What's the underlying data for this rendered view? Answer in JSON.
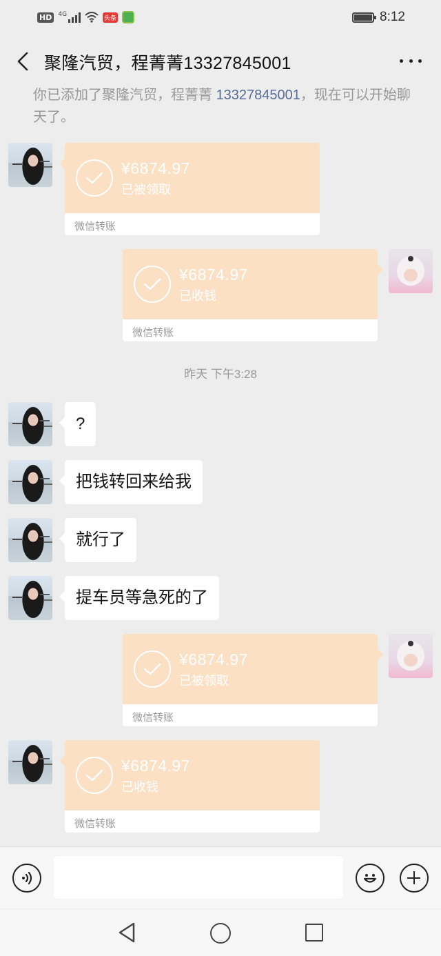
{
  "status_bar": {
    "hd": "HD",
    "network": "4G",
    "app_badge": "头条",
    "time": "8:12"
  },
  "header": {
    "title": "聚隆汽贸，程菁菁13327845001"
  },
  "system_notice": {
    "prefix": "你已添加了聚隆汽贸，程菁菁 ",
    "phone": "13327845001",
    "suffix": "，现在可以开始聊天了。"
  },
  "messages": [
    {
      "sender": "contact",
      "type": "transfer",
      "amount": "¥6874.97",
      "status": "已被领取",
      "footer": "微信转账"
    },
    {
      "sender": "me",
      "type": "transfer",
      "amount": "¥6874.97",
      "status": "已收钱",
      "footer": "微信转账"
    },
    {
      "type": "timestamp",
      "text": "昨天 下午3:28"
    },
    {
      "sender": "contact",
      "type": "text",
      "text": "?"
    },
    {
      "sender": "contact",
      "type": "text",
      "text": "把钱转回来给我"
    },
    {
      "sender": "contact",
      "type": "text",
      "text": "就行了"
    },
    {
      "sender": "contact",
      "type": "text",
      "text": "提车员等急死的了"
    },
    {
      "sender": "me",
      "type": "transfer",
      "amount": "¥6874.97",
      "status": "已被领取",
      "footer": "微信转账"
    },
    {
      "sender": "contact",
      "type": "transfer",
      "amount": "¥6874.97",
      "status": "已收钱",
      "footer": "微信转账"
    }
  ],
  "input_bar": {
    "value": "",
    "placeholder": ""
  },
  "icons": {
    "back": "back-arrow-icon",
    "more": "more-icon",
    "voice": "voice-icon",
    "emoji": "emoji-icon",
    "plus": "plus-icon",
    "transfer_check": "check-icon"
  },
  "colors": {
    "background": "#ededed",
    "transfer_card": "#fbe0c4",
    "link": "#576b95",
    "bubble": "#ffffff"
  }
}
